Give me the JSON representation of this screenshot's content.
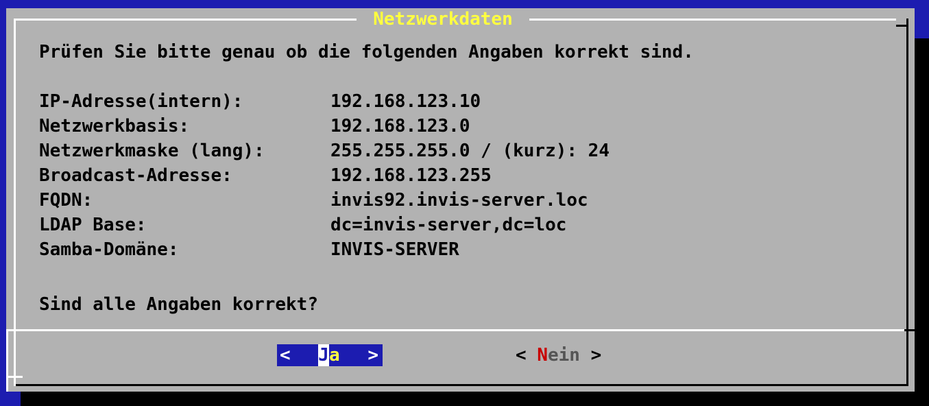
{
  "dialog": {
    "title": "Netzwerkdaten",
    "intro": "Prüfen Sie bitte genau ob die folgenden Angaben korrekt sind.",
    "rows": [
      {
        "label": "IP-Adresse(intern):",
        "value": "192.168.123.10"
      },
      {
        "label": "Netzwerkbasis:",
        "value": "192.168.123.0"
      },
      {
        "label": "Netzwerkmaske (lang):",
        "value": "255.255.255.0 / (kurz): 24"
      },
      {
        "label": "Broadcast-Adresse:",
        "value": "192.168.123.255"
      },
      {
        "label": "FQDN:",
        "value": "invis92.invis-server.loc"
      },
      {
        "label": "LDAP Base:",
        "value": "dc=invis-server,dc=loc"
      },
      {
        "label": "Samba-Domäne:",
        "value": "INVIS-SERVER"
      }
    ],
    "question": "Sind alle Angaben korrekt?"
  },
  "buttons": {
    "yes": {
      "left": "<",
      "hotkey": "J",
      "rest": "a",
      "right": ">"
    },
    "no": {
      "left": "< ",
      "hotkey": "N",
      "rest": "ein",
      "right": " >"
    }
  },
  "colors": {
    "background": "#1c1cb0",
    "dialog": "#b2b2b2",
    "title": "#ffff40",
    "hotkey_no": "#c80000"
  }
}
